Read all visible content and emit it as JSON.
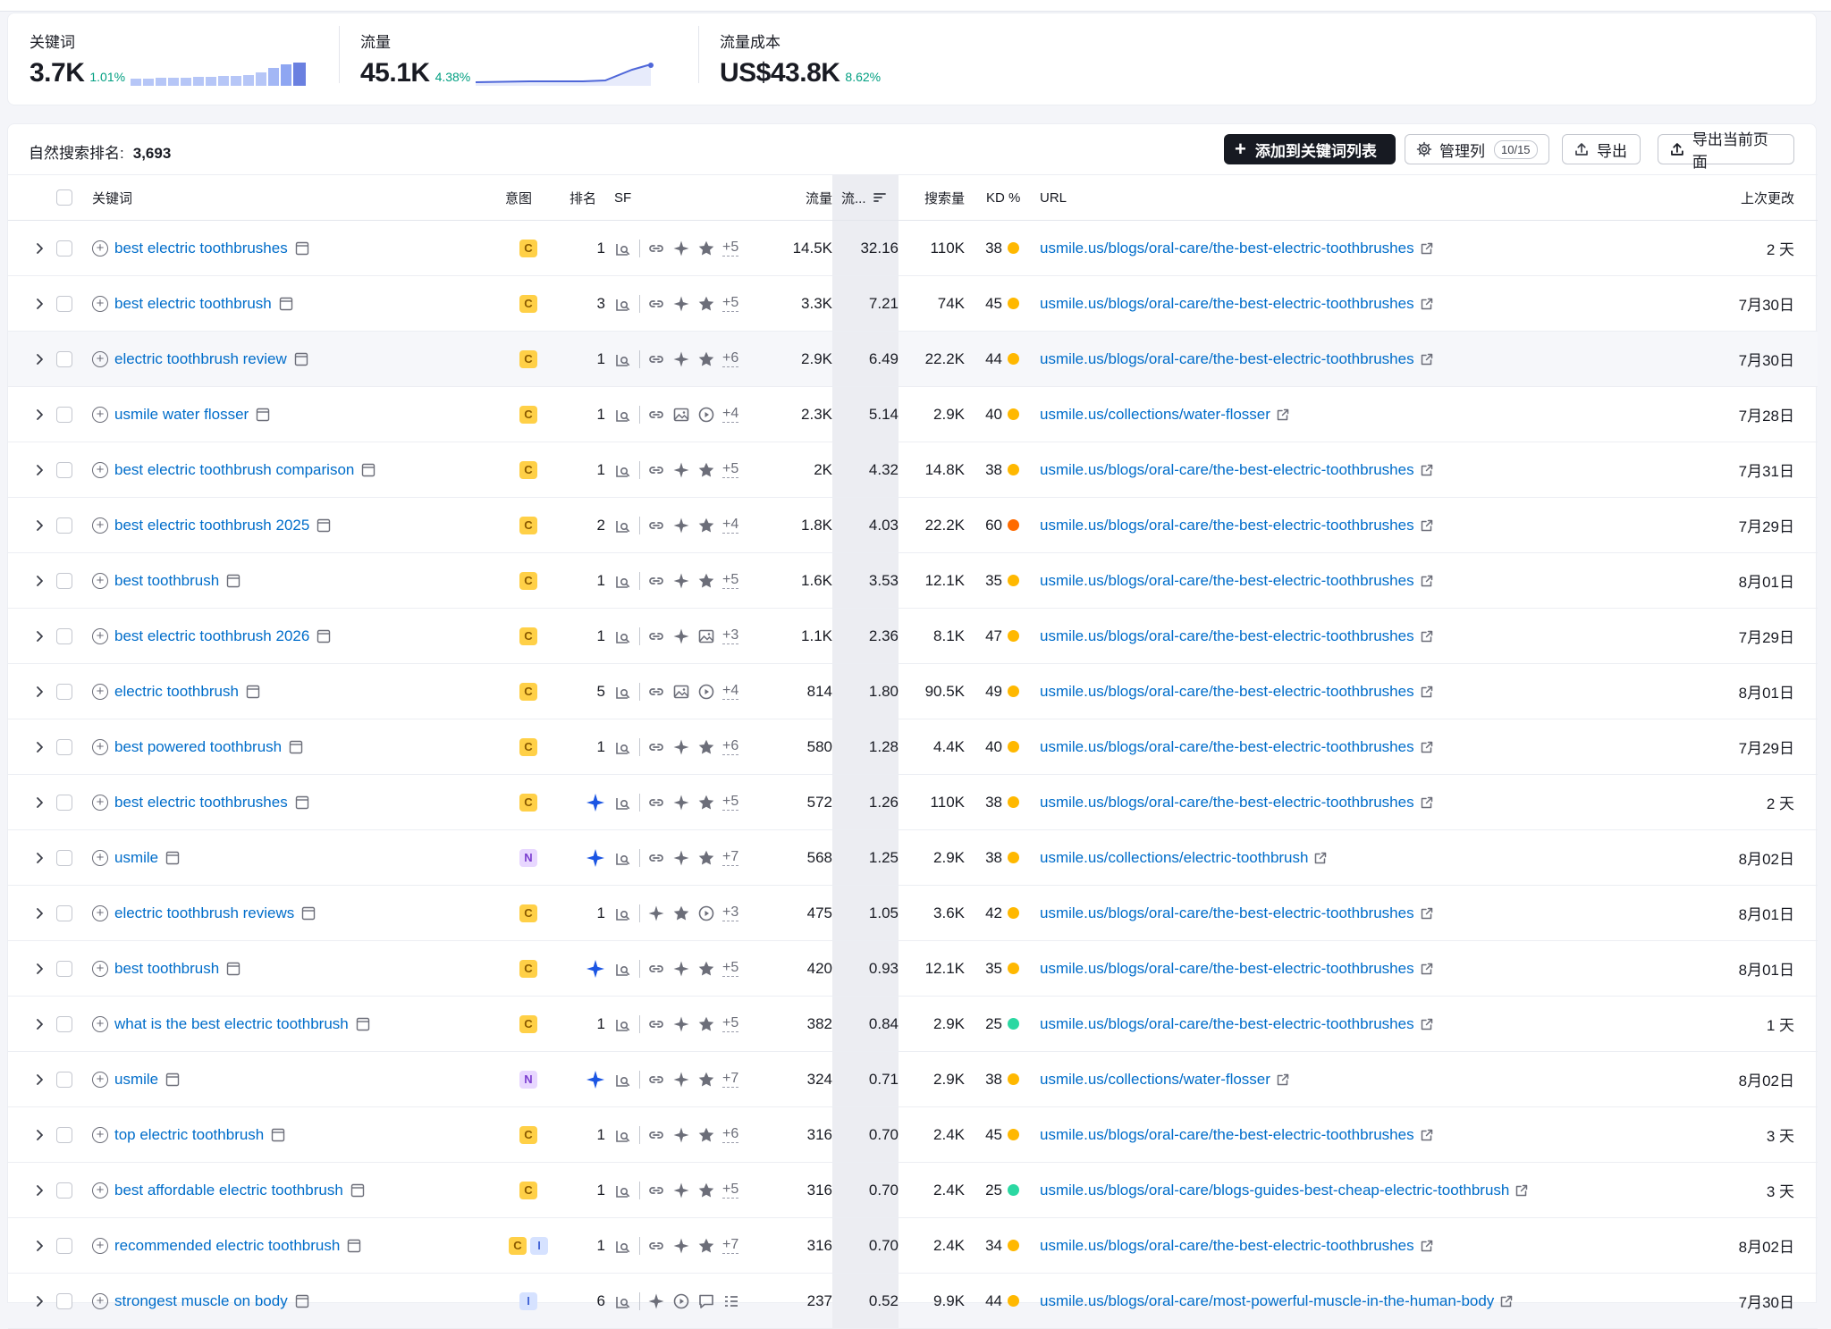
{
  "metrics": [
    {
      "label": "关键词",
      "value": "3.7K",
      "change": "1.01%"
    },
    {
      "label": "流量",
      "value": "45.1K",
      "change": "4.38%"
    },
    {
      "label": "流量成本",
      "value": "US$43.8K",
      "change": "8.62%"
    }
  ],
  "toolbar": {
    "rank_label": "自然搜索排名:",
    "rank_value": "3,693",
    "add_label": "添加到关键词列表",
    "columns_label": "管理列",
    "columns_count": "10/15",
    "export_label": "导出",
    "export_page_label": "导出当前页面"
  },
  "columns": {
    "keyword": "关键词",
    "intent": "意图",
    "position": "排名",
    "sf": "SF",
    "traffic": "流量",
    "traffic_pct": "流...",
    "volume": "搜索量",
    "kd": "KD %",
    "url": "URL",
    "updated": "上次更改"
  },
  "colors": {
    "kd_yellow": "#ffb800",
    "kd_orange": "#ff6b00",
    "kd_green": "#2bd8a2",
    "link": "#006dca"
  },
  "rows": [
    {
      "keyword": "best electric toothbrushes",
      "intent": [
        "C"
      ],
      "position": "1",
      "sf": [
        "link",
        "sparkle",
        "star"
      ],
      "sf_more": "+5",
      "traffic": "14.5K",
      "traffic_pct": "32.16",
      "volume": "110K",
      "kd": "38",
      "kd_color": "yellow",
      "url": "usmile.us/blogs/oral-care/the-best-electric-toothbrushes",
      "updated": "2 天"
    },
    {
      "keyword": "best electric toothbrush",
      "intent": [
        "C"
      ],
      "position": "3",
      "sf": [
        "link",
        "sparkle",
        "star"
      ],
      "sf_more": "+5",
      "traffic": "3.3K",
      "traffic_pct": "7.21",
      "volume": "74K",
      "kd": "45",
      "kd_color": "yellow",
      "url": "usmile.us/blogs/oral-care/the-best-electric-toothbrushes",
      "updated": "7月30日"
    },
    {
      "keyword": "electric toothbrush review",
      "intent": [
        "C"
      ],
      "position": "1",
      "sf": [
        "link",
        "sparkle",
        "star"
      ],
      "sf_more": "+6",
      "traffic": "2.9K",
      "traffic_pct": "6.49",
      "volume": "22.2K",
      "kd": "44",
      "kd_color": "yellow",
      "url": "usmile.us/blogs/oral-care/the-best-electric-toothbrushes",
      "updated": "7月30日",
      "highlight": true
    },
    {
      "keyword": "usmile water flosser",
      "intent": [
        "C"
      ],
      "position": "1",
      "sf": [
        "link",
        "image",
        "video"
      ],
      "sf_more": "+4",
      "traffic": "2.3K",
      "traffic_pct": "5.14",
      "volume": "2.9K",
      "kd": "40",
      "kd_color": "yellow",
      "url": "usmile.us/collections/water-flosser",
      "updated": "7月28日"
    },
    {
      "keyword": "best electric toothbrush comparison",
      "intent": [
        "C"
      ],
      "position": "1",
      "sf": [
        "link",
        "sparkle",
        "star"
      ],
      "sf_more": "+5",
      "traffic": "2K",
      "traffic_pct": "4.32",
      "volume": "14.8K",
      "kd": "38",
      "kd_color": "yellow",
      "url": "usmile.us/blogs/oral-care/the-best-electric-toothbrushes",
      "updated": "7月31日"
    },
    {
      "keyword": "best electric toothbrush 2025",
      "intent": [
        "C"
      ],
      "position": "2",
      "sf": [
        "link",
        "sparkle",
        "star"
      ],
      "sf_more": "+4",
      "traffic": "1.8K",
      "traffic_pct": "4.03",
      "volume": "22.2K",
      "kd": "60",
      "kd_color": "orange",
      "url": "usmile.us/blogs/oral-care/the-best-electric-toothbrushes",
      "updated": "7月29日"
    },
    {
      "keyword": "best toothbrush",
      "intent": [
        "C"
      ],
      "position": "1",
      "sf": [
        "link",
        "sparkle",
        "star"
      ],
      "sf_more": "+5",
      "traffic": "1.6K",
      "traffic_pct": "3.53",
      "volume": "12.1K",
      "kd": "35",
      "kd_color": "yellow",
      "url": "usmile.us/blogs/oral-care/the-best-electric-toothbrushes",
      "updated": "8月01日"
    },
    {
      "keyword": "best electric toothbrush 2026",
      "intent": [
        "C"
      ],
      "position": "1",
      "sf": [
        "link",
        "sparkle",
        "image"
      ],
      "sf_more": "+3",
      "traffic": "1.1K",
      "traffic_pct": "2.36",
      "volume": "8.1K",
      "kd": "47",
      "kd_color": "yellow",
      "url": "usmile.us/blogs/oral-care/the-best-electric-toothbrushes",
      "updated": "7月29日"
    },
    {
      "keyword": "electric toothbrush",
      "intent": [
        "C"
      ],
      "position": "5",
      "sf": [
        "link",
        "image",
        "video"
      ],
      "sf_more": "+4",
      "traffic": "814",
      "traffic_pct": "1.80",
      "volume": "90.5K",
      "kd": "49",
      "kd_color": "yellow",
      "url": "usmile.us/blogs/oral-care/the-best-electric-toothbrushes",
      "updated": "8月01日"
    },
    {
      "keyword": "best powered toothbrush",
      "intent": [
        "C"
      ],
      "position": "1",
      "sf": [
        "link",
        "sparkle",
        "star"
      ],
      "sf_more": "+6",
      "traffic": "580",
      "traffic_pct": "1.28",
      "volume": "4.4K",
      "kd": "40",
      "kd_color": "yellow",
      "url": "usmile.us/blogs/oral-care/the-best-electric-toothbrushes",
      "updated": "7月29日"
    },
    {
      "keyword": "best electric toothbrushes",
      "intent": [
        "C"
      ],
      "position": "",
      "ai_overview": true,
      "sf": [
        "link",
        "sparkle",
        "star"
      ],
      "sf_more": "+5",
      "traffic": "572",
      "traffic_pct": "1.26",
      "volume": "110K",
      "kd": "38",
      "kd_color": "yellow",
      "url": "usmile.us/blogs/oral-care/the-best-electric-toothbrushes",
      "updated": "2 天"
    },
    {
      "keyword": "usmile",
      "intent": [
        "N"
      ],
      "position": "",
      "ai_overview": true,
      "sf": [
        "link",
        "sparkle",
        "star"
      ],
      "sf_more": "+7",
      "traffic": "568",
      "traffic_pct": "1.25",
      "volume": "2.9K",
      "kd": "38",
      "kd_color": "yellow",
      "url": "usmile.us/collections/electric-toothbrush",
      "updated": "8月02日"
    },
    {
      "keyword": "electric toothbrush reviews",
      "intent": [
        "C"
      ],
      "position": "1",
      "sf": [
        "sparkle",
        "star",
        "video"
      ],
      "sf_more": "+3",
      "traffic": "475",
      "traffic_pct": "1.05",
      "volume": "3.6K",
      "kd": "42",
      "kd_color": "yellow",
      "url": "usmile.us/blogs/oral-care/the-best-electric-toothbrushes",
      "updated": "8月01日"
    },
    {
      "keyword": "best toothbrush",
      "intent": [
        "C"
      ],
      "position": "",
      "ai_overview": true,
      "sf": [
        "link",
        "sparkle",
        "star"
      ],
      "sf_more": "+5",
      "traffic": "420",
      "traffic_pct": "0.93",
      "volume": "12.1K",
      "kd": "35",
      "kd_color": "yellow",
      "url": "usmile.us/blogs/oral-care/the-best-electric-toothbrushes",
      "updated": "8月01日"
    },
    {
      "keyword": "what is the best electric toothbrush",
      "intent": [
        "C"
      ],
      "position": "1",
      "sf": [
        "link",
        "sparkle",
        "star"
      ],
      "sf_more": "+5",
      "traffic": "382",
      "traffic_pct": "0.84",
      "volume": "2.9K",
      "kd": "25",
      "kd_color": "green",
      "url": "usmile.us/blogs/oral-care/the-best-electric-toothbrushes",
      "updated": "1 天"
    },
    {
      "keyword": "usmile",
      "intent": [
        "N"
      ],
      "position": "",
      "ai_overview": true,
      "sf": [
        "link",
        "sparkle",
        "star"
      ],
      "sf_more": "+7",
      "traffic": "324",
      "traffic_pct": "0.71",
      "volume": "2.9K",
      "kd": "38",
      "kd_color": "yellow",
      "url": "usmile.us/collections/water-flosser",
      "updated": "8月02日"
    },
    {
      "keyword": "top electric toothbrush",
      "intent": [
        "C"
      ],
      "position": "1",
      "sf": [
        "link",
        "sparkle",
        "star"
      ],
      "sf_more": "+6",
      "traffic": "316",
      "traffic_pct": "0.70",
      "volume": "2.4K",
      "kd": "45",
      "kd_color": "yellow",
      "url": "usmile.us/blogs/oral-care/the-best-electric-toothbrushes",
      "updated": "3 天"
    },
    {
      "keyword": "best affordable electric toothbrush",
      "intent": [
        "C"
      ],
      "position": "1",
      "sf": [
        "link",
        "sparkle",
        "star"
      ],
      "sf_more": "+5",
      "traffic": "316",
      "traffic_pct": "0.70",
      "volume": "2.4K",
      "kd": "25",
      "kd_color": "green",
      "url": "usmile.us/blogs/oral-care/blogs-guides-best-cheap-electric-toothbrush",
      "updated": "3 天"
    },
    {
      "keyword": "recommended electric toothbrush",
      "intent": [
        "C",
        "I"
      ],
      "position": "1",
      "sf": [
        "link",
        "sparkle",
        "star"
      ],
      "sf_more": "+7",
      "traffic": "316",
      "traffic_pct": "0.70",
      "volume": "2.4K",
      "kd": "34",
      "kd_color": "yellow",
      "url": "usmile.us/blogs/oral-care/the-best-electric-toothbrushes",
      "updated": "8月02日"
    },
    {
      "keyword": "strongest muscle on body",
      "intent": [
        "I"
      ],
      "position": "6",
      "sf": [
        "sparkle",
        "video",
        "comment",
        "list"
      ],
      "sf_more": "",
      "traffic": "237",
      "traffic_pct": "0.52",
      "volume": "9.9K",
      "kd": "44",
      "kd_color": "yellow",
      "url": "usmile.us/blogs/oral-care/most-powerful-muscle-in-the-human-body",
      "updated": "7月30日"
    }
  ]
}
